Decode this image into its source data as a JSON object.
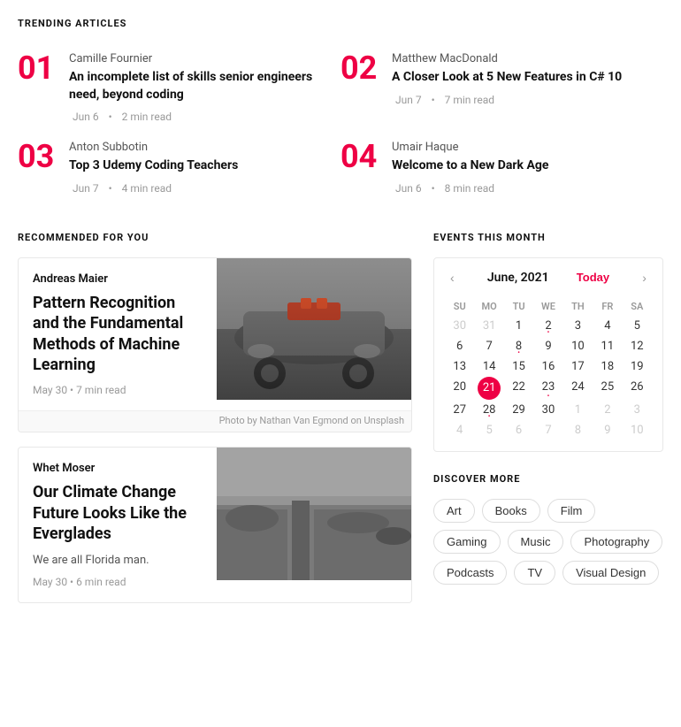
{
  "trending": {
    "section_title": "TRENDING ARTICLES",
    "items": [
      {
        "num": "01",
        "author": "Camille Fournier",
        "title": "An incomplete list of skills senior engineers need, beyond coding",
        "date": "Jun 6",
        "read_time": "2 min read"
      },
      {
        "num": "02",
        "author": "Matthew MacDonald",
        "title": "A Closer Look at 5 New Features in C# 10",
        "date": "Jun 7",
        "read_time": "7 min read"
      },
      {
        "num": "03",
        "author": "Anton Subbotin",
        "title": "Top 3 Udemy Coding Teachers",
        "date": "Jun 7",
        "read_time": "4 min read"
      },
      {
        "num": "04",
        "author": "Umair Haque",
        "title": "Welcome to a New Dark Age",
        "date": "Jun 6",
        "read_time": "8 min read"
      }
    ]
  },
  "recommended": {
    "section_title": "RECOMMENDED FOR YOU",
    "articles": [
      {
        "author": "Andreas Maier",
        "title": "Pattern Recognition and the Fundamental Methods of Machine Learning",
        "date": "May 30",
        "read_time": "7 min read",
        "photo_credit": "Photo by Nathan Van Egmond on Unsplash"
      },
      {
        "author": "Whet Moser",
        "title": "Our Climate Change Future Looks Like the Everglades",
        "excerpt": "We are all Florida man.",
        "date": "May 30",
        "read_time": "6 min read"
      }
    ]
  },
  "events": {
    "section_title": "EVENTS THIS MONTH",
    "calendar": {
      "month_year": "June, 2021",
      "today_label": "Today",
      "day_headers": [
        "SU",
        "MO",
        "TU",
        "WE",
        "TH",
        "FR",
        "SA"
      ],
      "weeks": [
        [
          {
            "day": "30",
            "type": "other"
          },
          {
            "day": "31",
            "type": "other"
          },
          {
            "day": "1",
            "type": "normal"
          },
          {
            "day": "2",
            "type": "dot"
          },
          {
            "day": "3",
            "type": "normal"
          },
          {
            "day": "4",
            "type": "normal"
          },
          {
            "day": "5",
            "type": "normal"
          }
        ],
        [
          {
            "day": "6",
            "type": "normal"
          },
          {
            "day": "7",
            "type": "normal"
          },
          {
            "day": "8",
            "type": "dot"
          },
          {
            "day": "9",
            "type": "normal"
          },
          {
            "day": "10",
            "type": "normal"
          },
          {
            "day": "11",
            "type": "normal"
          },
          {
            "day": "12",
            "type": "normal"
          }
        ],
        [
          {
            "day": "13",
            "type": "normal"
          },
          {
            "day": "14",
            "type": "normal"
          },
          {
            "day": "15",
            "type": "normal"
          },
          {
            "day": "16",
            "type": "normal"
          },
          {
            "day": "17",
            "type": "normal"
          },
          {
            "day": "18",
            "type": "normal"
          },
          {
            "day": "19",
            "type": "normal"
          }
        ],
        [
          {
            "day": "20",
            "type": "normal"
          },
          {
            "day": "21",
            "type": "today"
          },
          {
            "day": "22",
            "type": "normal"
          },
          {
            "day": "23",
            "type": "dot"
          },
          {
            "day": "24",
            "type": "normal"
          },
          {
            "day": "25",
            "type": "normal"
          },
          {
            "day": "26",
            "type": "normal"
          }
        ],
        [
          {
            "day": "27",
            "type": "normal"
          },
          {
            "day": "28",
            "type": "dot"
          },
          {
            "day": "29",
            "type": "normal"
          },
          {
            "day": "30",
            "type": "normal"
          },
          {
            "day": "1",
            "type": "other"
          },
          {
            "day": "2",
            "type": "other"
          },
          {
            "day": "3",
            "type": "other"
          }
        ],
        [
          {
            "day": "4",
            "type": "other"
          },
          {
            "day": "5",
            "type": "other"
          },
          {
            "day": "6",
            "type": "other"
          },
          {
            "day": "7",
            "type": "other"
          },
          {
            "day": "8",
            "type": "other"
          },
          {
            "day": "9",
            "type": "other"
          },
          {
            "day": "10",
            "type": "other"
          }
        ]
      ]
    }
  },
  "discover": {
    "section_title": "DISCOVER MORE",
    "tags": [
      "Art",
      "Books",
      "Film",
      "Gaming",
      "Music",
      "Photography",
      "Podcasts",
      "TV",
      "Visual Design"
    ]
  }
}
